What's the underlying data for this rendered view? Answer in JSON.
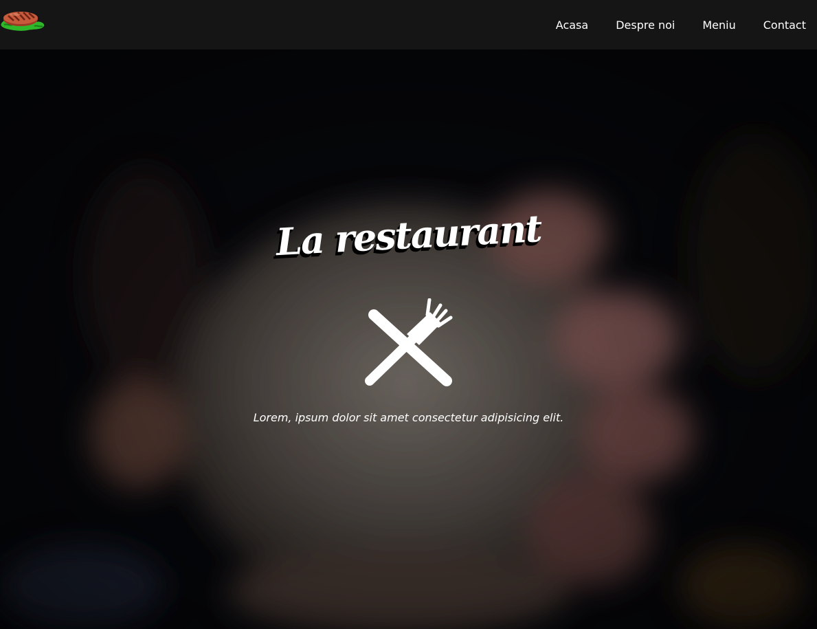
{
  "brand": {
    "logo_icon": "steak-logo-icon"
  },
  "nav": {
    "items": [
      {
        "label": "Acasa"
      },
      {
        "label": "Despre noi"
      },
      {
        "label": "Meniu"
      },
      {
        "label": "Contact"
      }
    ]
  },
  "hero": {
    "title": "La restaurant",
    "icon": "fork-knife-icon",
    "tagline": "Lorem, ipsum dolor sit amet consectetur adipisicing elit."
  },
  "colors": {
    "navbar_bg": "#151515",
    "text": "#ffffff",
    "hero_overlay": "#07080b"
  }
}
